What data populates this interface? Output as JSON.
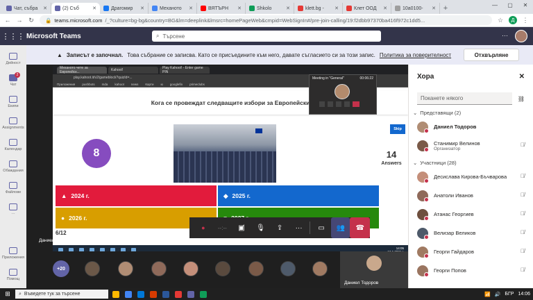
{
  "browser": {
    "tabs": [
      {
        "label": "Чат, събра",
        "color": "#6264a7",
        "active": false
      },
      {
        "label": "(2) Съб",
        "color": "#6264a7",
        "active": true
      },
      {
        "label": "Драгомир",
        "color": "#1877f2",
        "active": false
      },
      {
        "label": "Механото",
        "color": "#4285f4",
        "active": false
      },
      {
        "label": "ВЯТЪРН",
        "color": "#ff0000",
        "active": false
      },
      {
        "label": "Shkolo",
        "color": "#0f9d58",
        "active": false
      },
      {
        "label": "klett.bg - ",
        "color": "#e53935",
        "active": false
      },
      {
        "label": "Клет ООД",
        "color": "#e53935",
        "active": false
      },
      {
        "label": "10a0100-",
        "color": "#9e9e9e",
        "active": false
      }
    ],
    "url_host": "teams.microsoft.com",
    "url_rest": "/_?culture=bg-bg&country=BG&lm=deeplink&lmsrc=homePageWeb&cmpid=WebSignIn#/pre-join-calling/19:f2dbb97370ba416f972c1dd5...",
    "account_initial": "Д"
  },
  "teams": {
    "app_name": "Microsoft Teams",
    "search_placeholder": "Търсене",
    "more": "···"
  },
  "banner": {
    "bold": "Записът е започнал.",
    "text": "Това събрание се записва. Като се присъедините към него, давате съгласието си за този запис.",
    "link": "Политика за поверителност",
    "decline": "Отхвърляне"
  },
  "rail": [
    {
      "label": "Дейност",
      "badge": ""
    },
    {
      "label": "Чат",
      "badge": "2"
    },
    {
      "label": "Екипи",
      "badge": ""
    },
    {
      "label": "Assignments",
      "badge": ""
    },
    {
      "label": "Календар",
      "badge": ""
    },
    {
      "label": "Обаждания",
      "badge": ""
    },
    {
      "label": "Файлове",
      "badge": ""
    },
    {
      "label": "···",
      "badge": ""
    }
  ],
  "rail_bottom": [
    {
      "label": "Приложения"
    },
    {
      "label": "Помощ"
    }
  ],
  "shared": {
    "tabs": [
      "Механото чете за Европейск...",
      "Kahoot!",
      "Play Kahoot! - Enter game PIN"
    ],
    "address": "play.kahoot.it/v2/gameblock?quizId=...",
    "bookmarks": [
      "Приложения",
      "pushbots",
      "mda",
      "kahoot",
      "news",
      "Карти",
      "ю",
      "googlefin",
      "primeclubs"
    ],
    "question": "Кога се провеждат следващите избори за Европейски",
    "timer": "8",
    "skip": "Skip",
    "answers_count": "14",
    "answers_label": "Answers",
    "answers": [
      {
        "symbol": "▲",
        "text": "2024 г."
      },
      {
        "symbol": "◆",
        "text": "2025 г."
      },
      {
        "symbol": "●",
        "text": "2026 г."
      },
      {
        "symbol": "■",
        "text": "2027 г."
      }
    ],
    "progress": "6/12",
    "clock_time": "14:05",
    "clock_date": "12.1.2021 г.",
    "mini_title": "Meeting in \"General\"",
    "mini_time": "00:06:22",
    "presenter": "Даниел Т..."
  },
  "controls": {
    "timer": "--:--"
  },
  "strip": {
    "more": "+20",
    "self_name": "Даниел Тодоров"
  },
  "people": {
    "title": "Хора",
    "invite_placeholder": "Поканете някого",
    "presenters_label": "Представящи (2)",
    "attendees_label": "Участници (28)",
    "presenters": [
      {
        "name": "Даниел Тодоров",
        "role": "",
        "bold": true,
        "color": "#b08d74"
      },
      {
        "name": "Станимир Велинов",
        "role": "Организатор",
        "bold": false,
        "color": "#7a5a48"
      }
    ],
    "attendees": [
      {
        "name": "Десислава Кирова-Бъчварова",
        "color": "#c48f7a"
      },
      {
        "name": "Анатоли Иванов",
        "color": "#8f6a5a"
      },
      {
        "name": "Атанас Георгиев",
        "color": "#6e4f3e"
      },
      {
        "name": "Велизар Великов",
        "color": "#4e5a6a"
      },
      {
        "name": "Георги Гайдаров",
        "color": "#a07a62"
      },
      {
        "name": "Георги Попов",
        "color": "#9a7560"
      }
    ]
  },
  "taskbar": {
    "search": "Въведете тук за търсене",
    "lang": "БГР",
    "time": "14:06"
  }
}
